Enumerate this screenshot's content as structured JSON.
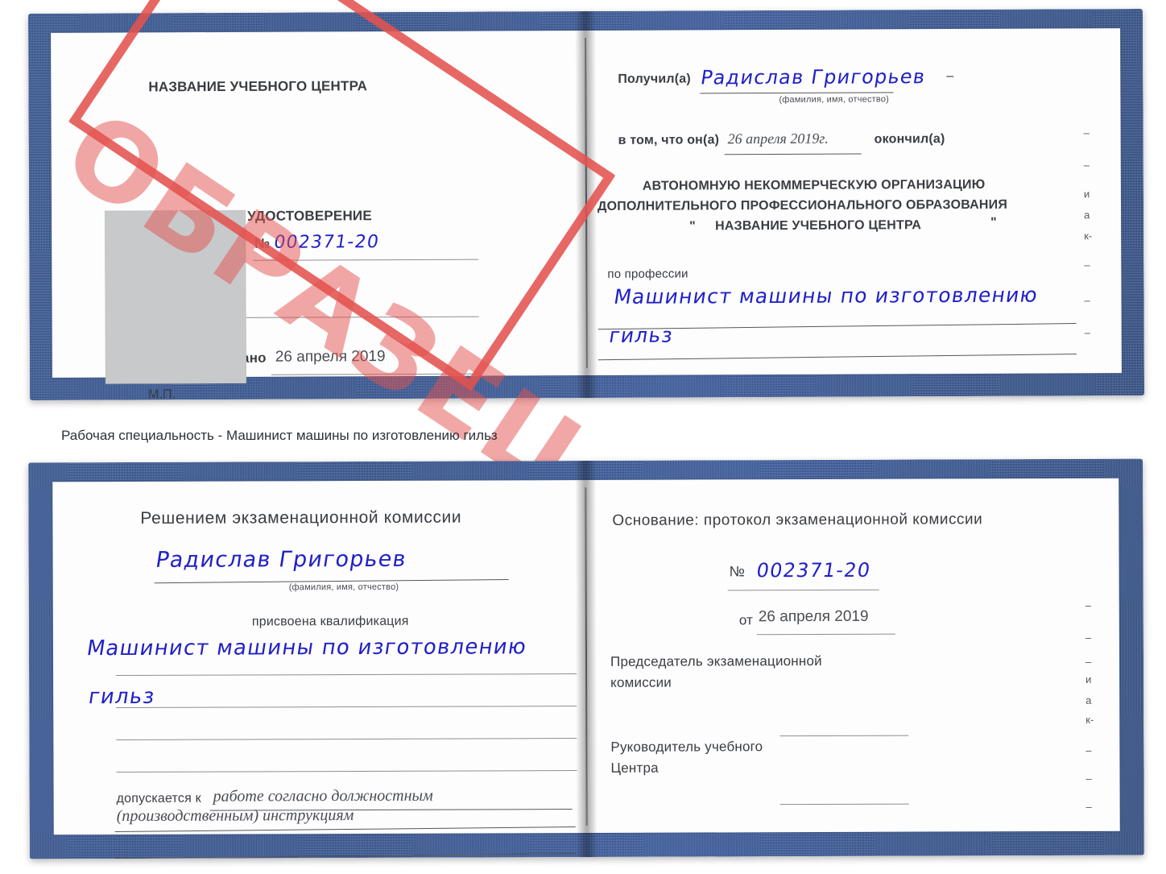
{
  "document": {
    "type": "certificate-sample",
    "caption": "Рабочая специальность - Машинист машины по изготовлению гильз",
    "stamp_label": "ОБРАЗЕЦ",
    "stamp_color": "#e4524f",
    "cover_color": "#2d4f91",
    "ink_color": "#2020c8"
  },
  "certificate_top": {
    "left_page": {
      "org_header": "НАЗВАНИЕ УЧЕБНОГО ЦЕНТРА",
      "title": "УДОСТОВЕРЕНИЕ",
      "number_label": "№",
      "number_value": "002371-20",
      "issued_label": "Выдано",
      "issued_value": "26 апреля 2019",
      "seal_label": "М.П."
    },
    "right_page": {
      "received_label": "Получил(а)",
      "received_value": "Радислав Григорьев",
      "received_hint": "(фамилия, имя, отчество)",
      "in_that_label": "в том, что он(а)",
      "in_that_value": "26 апреля 2019г.",
      "finished_label": "окончил(а)",
      "org_line1": "АВТОНОМНУЮ НЕКОММЕРЧЕСКУЮ ОРГАНИЗАЦИЮ",
      "org_line2": "ДОПОЛНИТЕЛЬНОГО ПРОФЕССИОНАЛЬНОГО ОБРАЗОВАНИЯ",
      "org_quote_open": "\"",
      "org_line3": "НАЗВАНИЕ УЧЕБНОГО ЦЕНТРА",
      "org_quote_close": "\"",
      "profession_label": "по профессии",
      "profession_value_line1": "Машинист машины по изготовлению",
      "profession_value_line2": "гильз"
    }
  },
  "certificate_bottom": {
    "left_page": {
      "heading": "Решением экзаменационной комиссии",
      "name_value": "Радислав Григорьев",
      "name_hint": "(фамилия, имя, отчество)",
      "qualification_label": "присвоена квалификация",
      "qualification_line1": "Машинист машины по изготовлению",
      "qualification_line2": "гильз",
      "admitted_label": "допускается к",
      "admitted_value_line1": "работе согласно должностным",
      "admitted_value_line2": "(производственным) инструкциям"
    },
    "right_page": {
      "basis_label": "Основание: протокол экзаменационной комиссии",
      "number_label": "№",
      "number_value": "002371-20",
      "date_label": "от",
      "date_value": "26 апреля 2019",
      "chairman_line1": "Председатель экзаменационной",
      "chairman_line2": "комиссии",
      "head_line1": "Руководитель учебного",
      "head_line2": "Центра"
    }
  },
  "bleed_glyphs": {
    "top": [
      "–",
      "–",
      "–",
      "и",
      "а",
      "к-",
      "–",
      "–",
      "–"
    ],
    "bottom": [
      "–",
      "–",
      "–",
      "и",
      "а",
      "к-",
      "–",
      "–",
      "–"
    ]
  }
}
